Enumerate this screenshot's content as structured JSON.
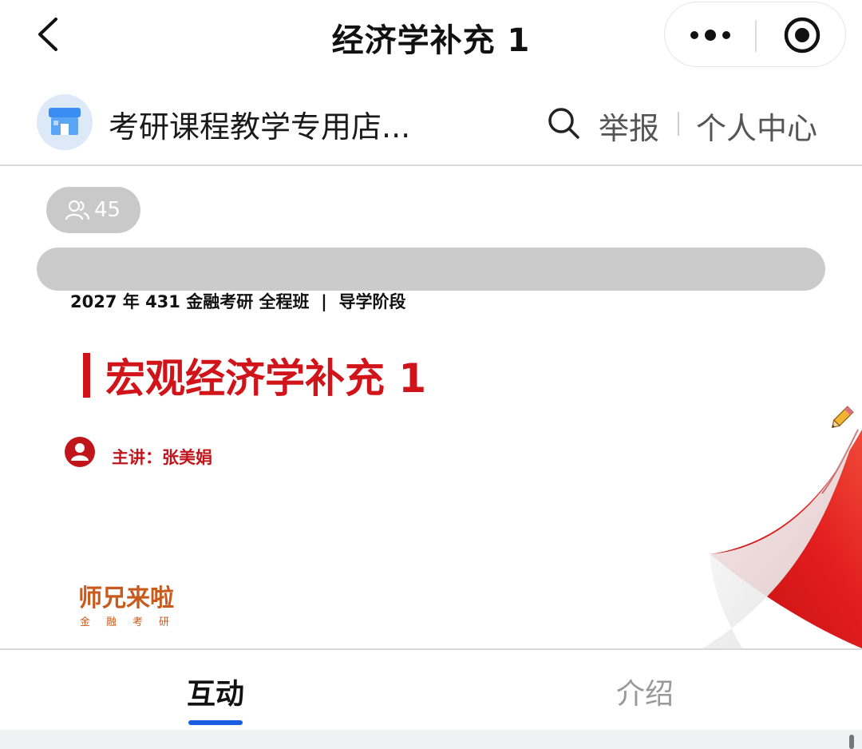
{
  "nav": {
    "title": "经济学补充 1",
    "back_icon": "chevron-left-icon",
    "more_icon": "more-dots-icon",
    "close_icon": "target-icon"
  },
  "shop": {
    "avatar_icon": "store-icon",
    "name": "考研课程教学专用店...",
    "search_icon": "search-icon",
    "report": "举报",
    "profile": "个人中心"
  },
  "player": {
    "viewer_icon": "users-icon",
    "viewer_count": "45",
    "slide": {
      "subtitle": "2027 年 431 金融考研 全程班  |  导学阶段",
      "title": "宏观经济学补充 1",
      "lecturer": "主讲：张美娟",
      "logo_main": "师兄来啦",
      "logo_sub": "金融考研"
    }
  },
  "tabs": [
    {
      "label": "互动",
      "active": true
    },
    {
      "label": "介绍",
      "active": false
    }
  ],
  "colors": {
    "accent_blue": "#1a5fe0",
    "slide_red": "#d0141a",
    "logo_orange": "#c85a1e"
  }
}
